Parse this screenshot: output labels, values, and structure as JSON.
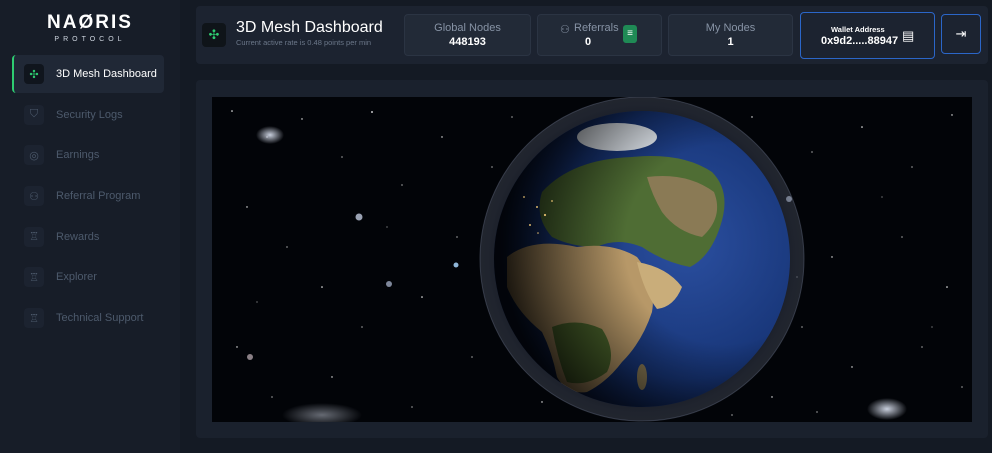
{
  "brand": {
    "name": "NAØRIS",
    "subtitle": "PROTOCOL"
  },
  "sidebar": {
    "items": [
      {
        "label": "3D Mesh Dashboard",
        "icon": "mesh-icon",
        "active": true
      },
      {
        "label": "Security Logs",
        "icon": "shield-icon",
        "active": false
      },
      {
        "label": "Earnings",
        "icon": "coins-icon",
        "active": false
      },
      {
        "label": "Referral Program",
        "icon": "users-icon",
        "active": false
      },
      {
        "label": "Rewards",
        "icon": "trophy-icon",
        "active": false
      },
      {
        "label": "Explorer",
        "icon": "trophy-icon",
        "active": false
      },
      {
        "label": "Technical Support",
        "icon": "trophy-icon",
        "active": false
      }
    ]
  },
  "header": {
    "title": "3D Mesh Dashboard",
    "subtitle": "Current active rate is 0.48 points per min",
    "stats": {
      "global_nodes": {
        "label": "Global Nodes",
        "value": "448193"
      },
      "referrals": {
        "label": "Referrals",
        "value": "0"
      },
      "my_nodes": {
        "label": "My Nodes",
        "value": "1"
      }
    },
    "wallet": {
      "label": "Wallet Address",
      "value": "0x9d2.....88947"
    }
  },
  "colors": {
    "accent": "#2ecc71",
    "wallet_border": "#2b66c8",
    "background": "#141a24"
  }
}
